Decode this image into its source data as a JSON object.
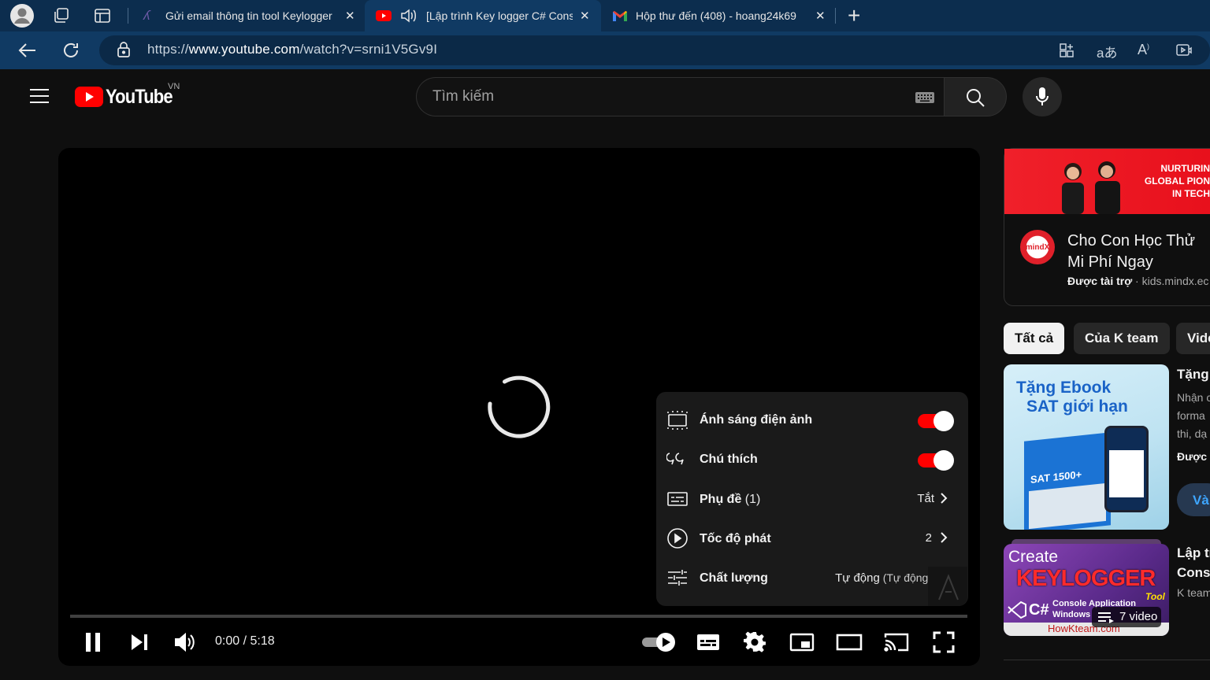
{
  "browser": {
    "tabs": [
      {
        "title": "Gửi email thông tin tool Keylogger",
        "close": "✕"
      },
      {
        "title": "[Lập trình Key logger C# Console",
        "close": "✕"
      },
      {
        "title": "Hộp thư đến (408) - hoang24k69",
        "close": "✕"
      }
    ],
    "new_tab": "+",
    "url_prefix": "https://",
    "url_host": "www.youtube.com",
    "url_path": "/watch?v=srni1V5Gv9I"
  },
  "youtube": {
    "logo_text": "YouTube",
    "region": "VN",
    "search_placeholder": "Tìm kiếm"
  },
  "player": {
    "current_time": "0:00 / 5:18",
    "progress": 0,
    "settings": [
      {
        "label": "Ánh sáng điện ảnh",
        "sub": "",
        "value": "",
        "type": "toggle",
        "on": true
      },
      {
        "label": "Chú thích",
        "sub": "",
        "value": "",
        "type": "toggle",
        "on": true
      },
      {
        "label": "Phụ đề",
        "sub": " (1)",
        "value": "Tắt",
        "type": "submenu"
      },
      {
        "label": "Tốc độ phát",
        "sub": "",
        "value": "2",
        "type": "submenu"
      },
      {
        "label": "Chất lượng",
        "sub": "",
        "value": "Tự động",
        "value_sub": " (Tự động)",
        "type": "submenu"
      }
    ]
  },
  "sidebar": {
    "ad": {
      "banner_line1": "NURTURIN",
      "banner_line2": "GLOBAL PION",
      "banner_line3": "IN TECH",
      "title": "Cho Con Học Thử Mi Phí Ngay",
      "sponsored": "Được tài trợ",
      "domain": "kids.mindx.ec",
      "logo_text": "mindX"
    },
    "chips": [
      "Tất cả",
      "Của K team",
      "Vide"
    ],
    "videos": [
      {
        "title": "Tặng",
        "desc_lines": [
          "Nhận c",
          "forma",
          "thi, dạ"
        ],
        "meta": "Được",
        "action": "Và",
        "thumb_line1": "Tặng Ebook",
        "thumb_line2": "SAT giới hạn",
        "thumb_book": "SAT 1500+"
      },
      {
        "title_lines": [
          "Lập tr",
          "Conso"
        ],
        "channel": "K team",
        "playlist_count": "7 video",
        "thumb_create": "Create",
        "thumb_key": "KEYLOGGER",
        "thumb_tool": "Tool",
        "thumb_cs": "C#",
        "thumb_sub": "Console Application",
        "thumb_sub2": "Windows",
        "thumb_site": "HowKteam.com"
      }
    ]
  },
  "colors": {
    "accent": "#ff0000",
    "tab_bar": "#0c2d4e",
    "address_bar": "#103a63",
    "page_bg": "#0f0f0f"
  }
}
